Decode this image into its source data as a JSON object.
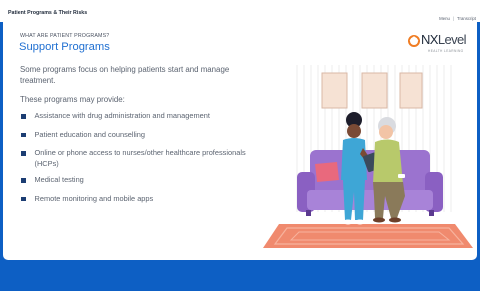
{
  "header": {
    "course_title": "Patient Programs & Their Risks",
    "nav": {
      "menu_label": "Menu",
      "separator": "|",
      "transcript_label": "Transcript"
    }
  },
  "slide": {
    "section_label": "WHAT ARE PATIENT PROGRAMS?",
    "title": "Support Programs",
    "intro": "Some programs focus on helping patients start and manage treatment.",
    "lead": "These programs may provide:",
    "bullets": [
      "Assistance with drug administration and management",
      "Patient education and counselling",
      "Online or phone access to nurses/other healthcare professionals (HCPs)",
      "Medical testing",
      "Remote monitoring and mobile apps"
    ]
  },
  "logo": {
    "main": "NX",
    "second": "Level",
    "tagline": "HEALTH LEARNING"
  },
  "colors": {
    "frame": "#0d5fc4",
    "title_accent": "#1f6fd1",
    "bullet": "#1c3d73",
    "sofa": "#9b73cf",
    "rug": "#f08a6e",
    "logo_orange": "#f07c22"
  },
  "icons": {
    "bullet": "square-bullet-icon",
    "logo": "nxlevel-logo-icon"
  }
}
